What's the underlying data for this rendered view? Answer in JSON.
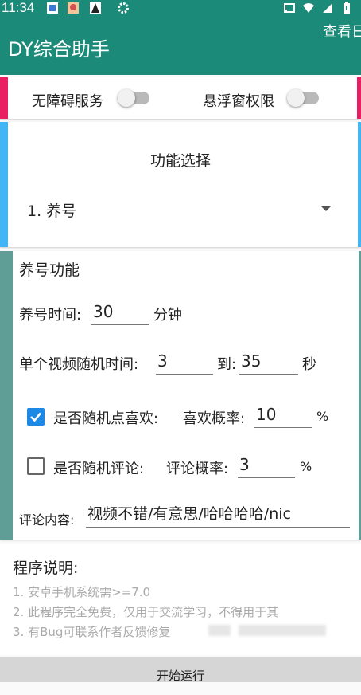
{
  "status_bar": {
    "time": "11:34"
  },
  "app_bar": {
    "title": "DY综合助手",
    "view_log_label": "查看日"
  },
  "permissions": {
    "accessibility_label": "无障碍服务",
    "accessibility_enabled": false,
    "overlay_label": "悬浮窗权限",
    "overlay_enabled": false
  },
  "function_select": {
    "title": "功能选择",
    "selected": "1. 养号"
  },
  "nurture": {
    "section_title": "养号功能",
    "time_label": "养号时间:",
    "time_value": "30",
    "time_unit": "分钟",
    "video_time_label": "单个视频随机时间:",
    "video_time_min": "3",
    "video_time_to": "到:",
    "video_time_max": "35",
    "video_time_unit": "秒",
    "like_checkbox_label": "是否随机点喜欢:",
    "like_checked": true,
    "like_prob_label": "喜欢概率:",
    "like_prob_value": "10",
    "like_prob_unit": "%",
    "comment_checkbox_label": "是否随机评论:",
    "comment_checked": false,
    "comment_prob_label": "评论概率:",
    "comment_prob_value": "3",
    "comment_prob_unit": "%",
    "comment_content_label": "评论内容:",
    "comment_content_value": "视频不错/有意思/哈哈哈哈/nic"
  },
  "notes": {
    "title": "程序说明:",
    "lines": [
      "1. 安卓手机系统需>=7.0",
      "2. 此程序完全免费，仅用于交流学习，不得用于其",
      "3. 有Bug可联系作者反馈修复"
    ]
  },
  "start_button_label": "开始运行",
  "colors": {
    "primary": "#1b8a78",
    "pink": "#e91e63",
    "blue": "#42b6f5",
    "teal_bar": "#5e9e97",
    "checkbox": "#1e88e5"
  }
}
